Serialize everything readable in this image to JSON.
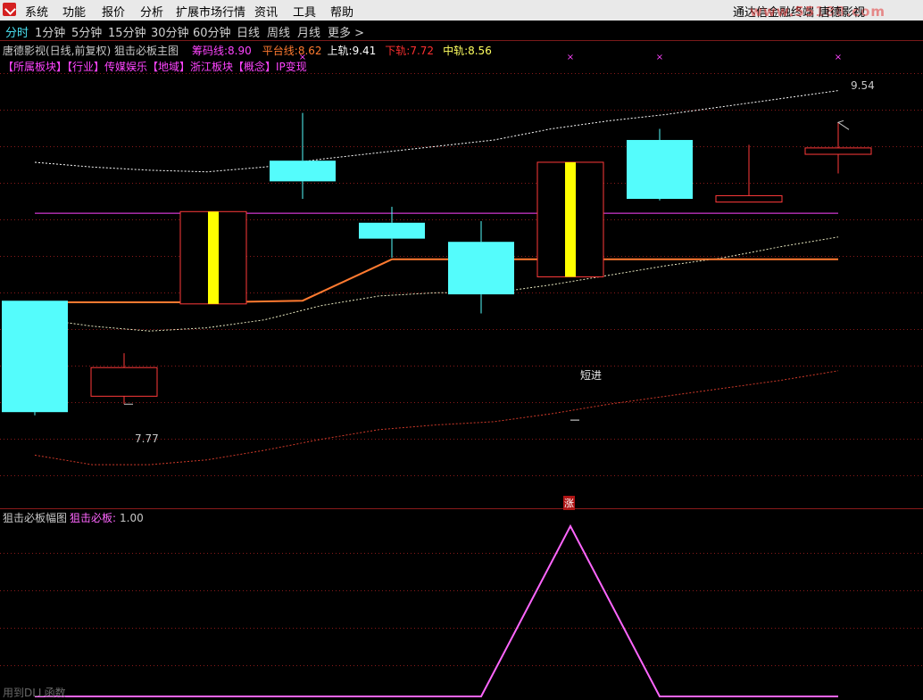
{
  "menu": {
    "items": [
      "系统",
      "功能",
      "报价",
      "分析",
      "扩展市场行情",
      "资讯",
      "工具",
      "帮助"
    ],
    "brand_text": "通达信金融终端",
    "user_text": "唐德影视",
    "watermark": "www.55188.com"
  },
  "tabs": [
    "分时",
    "1分钟",
    "5分钟",
    "15分钟",
    "30分钟",
    "60分钟",
    "日线",
    "周线",
    "月线",
    "更多 >"
  ],
  "active_tab_index": 0,
  "main_panel": {
    "title": "唐德影视(日线,前复权) 狙击必板主图",
    "indicators": [
      {
        "label": "筹码线:",
        "value": "8.90",
        "color": "#ff44ff"
      },
      {
        "label": "平台线:",
        "value": "8.62",
        "color": "#ff7a30"
      },
      {
        "label": "上轨:",
        "value": "9.41",
        "color": "#ffffff"
      },
      {
        "label": "下轨:",
        "value": "7.72",
        "color": "#ff3030"
      },
      {
        "label": "中轨:",
        "value": "8.56",
        "color": "#ffff60"
      }
    ],
    "sector_text": "【所属板块】【行业】传媒娱乐【地域】浙江板块【概念】IP变现",
    "annotation_high": "9.54",
    "annotation_low": "7.77",
    "annotation_signal": "短进",
    "rise_marker": "涨"
  },
  "sub_panel": {
    "title": "狙击必板幅图",
    "indicator_label": "狙击必板:",
    "indicator_value": "1.00"
  },
  "footer_text": "用到DLL函数",
  "colors": {
    "rise": "#ff3a3a",
    "fall": "#54fcfc",
    "signal_bar": "#ffff00",
    "upper_band": "#ffffff",
    "lower_band": "#d03a2a",
    "platform_line": "#ff7a30",
    "chip_line": "#ff44ff",
    "sub_line": "#ff66ff"
  },
  "chart_data": {
    "type": "candlestick",
    "y_range": [
      7.2,
      9.85
    ],
    "candles": [
      {
        "open": 8.42,
        "close": 7.72,
        "high": 8.42,
        "low": 7.7,
        "dir": "down"
      },
      {
        "open": 7.82,
        "close": 8.0,
        "high": 8.09,
        "low": 7.77,
        "dir": "up",
        "min_label": true
      },
      {
        "open": 8.4,
        "close": 8.98,
        "high": 8.98,
        "low": 8.4,
        "dir": "up",
        "signal": true
      },
      {
        "open": 9.3,
        "close": 9.17,
        "high": 9.6,
        "low": 9.06,
        "dir": "down"
      },
      {
        "open": 8.91,
        "close": 8.81,
        "high": 9.01,
        "low": 8.69,
        "dir": "down"
      },
      {
        "open": 8.79,
        "close": 8.46,
        "high": 8.92,
        "low": 8.34,
        "dir": "down"
      },
      {
        "open": 8.57,
        "close": 9.29,
        "high": 9.29,
        "low": 8.57,
        "dir": "up",
        "signal": true,
        "signal_label": true
      },
      {
        "open": 9.43,
        "close": 9.06,
        "high": 9.5,
        "low": 9.05,
        "dir": "down"
      },
      {
        "open": 9.04,
        "close": 9.08,
        "high": 9.4,
        "low": 9.04,
        "dir": "up"
      },
      {
        "open": 9.34,
        "close": 9.38,
        "high": 9.54,
        "low": 9.22,
        "dir": "up",
        "max_label": true
      }
    ],
    "upper_band": [
      9.29,
      9.26,
      9.24,
      9.23,
      9.26,
      9.31,
      9.35,
      9.39,
      9.43,
      9.5,
      9.55,
      9.59,
      9.64,
      9.69,
      9.74
    ],
    "middle_band": [
      8.31,
      8.26,
      8.23,
      8.25,
      8.3,
      8.39,
      8.45,
      8.47,
      8.47,
      8.52,
      8.58,
      8.64,
      8.69,
      8.76,
      8.82
    ],
    "lower_band": [
      7.45,
      7.39,
      7.39,
      7.42,
      7.48,
      7.55,
      7.61,
      7.64,
      7.66,
      7.71,
      7.77,
      7.82,
      7.87,
      7.92,
      7.98
    ],
    "platform_line": [
      8.41,
      8.41,
      8.41,
      8.42,
      8.68,
      8.68,
      8.68,
      8.68,
      8.68,
      8.68
    ],
    "chip_line_value": 8.97,
    "sub_series": [
      0,
      0,
      0,
      0,
      0,
      0,
      1,
      0,
      0,
      0
    ],
    "sub_y_range": [
      0,
      1
    ]
  }
}
